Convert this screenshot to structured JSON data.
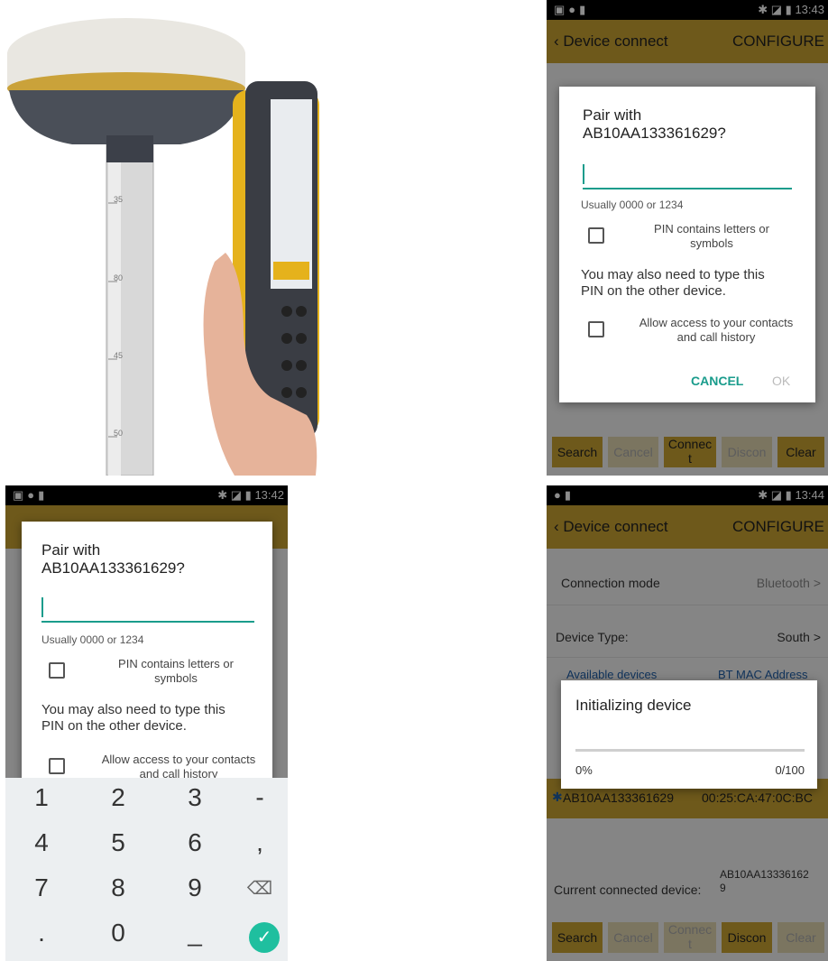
{
  "device_photo": {
    "pole_marks": [
      "35",
      "80",
      "45",
      "50"
    ]
  },
  "screen_tr": {
    "status": {
      "time": "13:43"
    },
    "appbar": {
      "back": "Device connect",
      "configure": "CONFIGURE"
    },
    "dialog": {
      "title": "Pair with\nAB10AA133361629?",
      "hint": "Usually 0000 or 1234",
      "cb1": "PIN contains letters or\nsymbols",
      "para": "You may also need to type this\nPIN on the other device.",
      "cb2": "Allow access to your contacts\nand call history",
      "cancel": "CANCEL",
      "ok": "OK"
    },
    "buttons": {
      "search": "Search",
      "cancel": "Cancel",
      "connect": "Connec\nt",
      "disconnect": "Discon",
      "clear": "Clear"
    }
  },
  "screen_bl": {
    "status": {
      "time": "13:42"
    },
    "dialog": {
      "title": "Pair with\nAB10AA133361629?",
      "hint": "Usually 0000 or 1234",
      "cb1": "PIN contains letters or\nsymbols",
      "para": "You may also need to type this\nPIN on the other device.",
      "cb2": "Allow access to your contacts\nand call history"
    },
    "keypad": {
      "k1": "1",
      "k2": "2",
      "k3": "3",
      "kdash": "-",
      "k4": "4",
      "k5": "5",
      "k6": "6",
      "kcomma": ",",
      "k7": "7",
      "k8": "8",
      "k9": "9",
      "kdot": ".",
      "k0": "0"
    }
  },
  "screen_br": {
    "status": {
      "time": "13:44"
    },
    "appbar": {
      "back": "Device connect",
      "configure": "CONFIGURE"
    },
    "connection_mode": {
      "label": "Connection mode",
      "value": "Bluetooth >"
    },
    "device_type": {
      "label": "Device Type:",
      "value": "South >"
    },
    "columns": {
      "available": "Available devices",
      "mac": "BT MAC Address"
    },
    "selected_device": {
      "name": "AB10AA133361629",
      "mac": "00:25:CA:47:0C:BC"
    },
    "progress_dialog": {
      "title": "Initializing device",
      "percent": "0%",
      "count": "0/100",
      "progress": 0
    },
    "current_device": {
      "label": "Current connected device:",
      "value": "AB10AA13336162\n9"
    },
    "buttons": {
      "search": "Search",
      "cancel": "Cancel",
      "connect": "Connec\nt",
      "disconnect": "Discon",
      "clear": "Clear"
    }
  },
  "colors": {
    "accent": "#c9a232",
    "teal": "#1a9c8c"
  }
}
